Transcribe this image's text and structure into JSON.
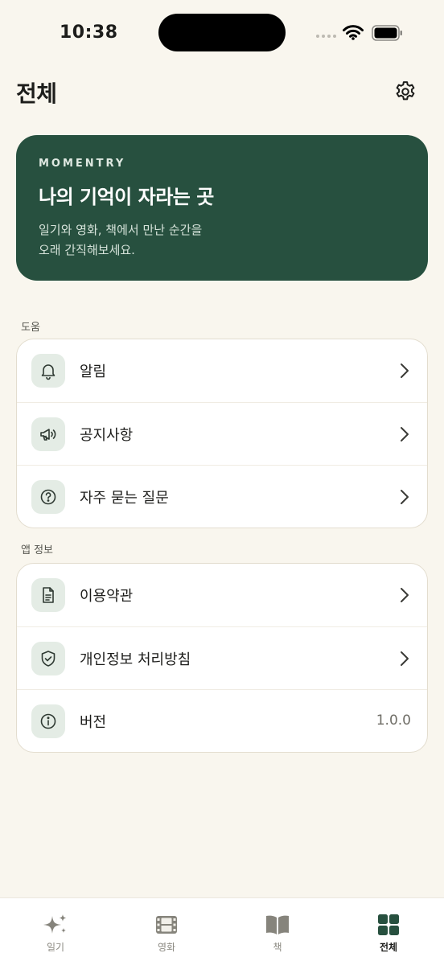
{
  "status": {
    "time": "10:38"
  },
  "header": {
    "title": "전체"
  },
  "hero": {
    "brand": "MOMENTRY",
    "title": "나의 기억이 자라는 곳",
    "description": "일기와 영화, 책에서 만난 순간을\n오래 간직해보세요."
  },
  "sections": {
    "help": {
      "label": "도움",
      "items": [
        {
          "label": "알림",
          "icon": "bell-icon"
        },
        {
          "label": "공지사항",
          "icon": "megaphone-icon"
        },
        {
          "label": "자주 묻는 질문",
          "icon": "question-icon"
        }
      ]
    },
    "app_info": {
      "label": "앱 정보",
      "items": [
        {
          "label": "이용약관",
          "icon": "document-icon"
        },
        {
          "label": "개인정보 처리방침",
          "icon": "shield-check-icon"
        },
        {
          "label": "버전",
          "icon": "info-icon",
          "value": "1.0.0"
        }
      ]
    }
  },
  "tabs": [
    {
      "label": "일기",
      "icon": "sparkle-icon"
    },
    {
      "label": "영화",
      "icon": "film-icon"
    },
    {
      "label": "책",
      "icon": "book-icon"
    },
    {
      "label": "전체",
      "icon": "grid-icon",
      "active": true
    }
  ],
  "colors": {
    "background": "#f9f6ee",
    "accent": "#27503f",
    "icon_bg": "#e4ece5"
  }
}
